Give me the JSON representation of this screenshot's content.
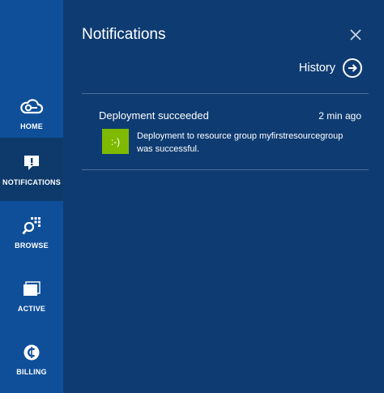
{
  "sidebar": {
    "items": [
      {
        "label": "HOME",
        "icon": "cloud-icon"
      },
      {
        "label": "NOTIFICATIONS",
        "icon": "notification-icon"
      },
      {
        "label": "BROWSE",
        "icon": "browse-icon"
      },
      {
        "label": "ACTIVE",
        "icon": "active-windows-icon"
      },
      {
        "label": "BILLING",
        "icon": "billing-icon"
      }
    ],
    "active_index": 1
  },
  "panel": {
    "title": "Notifications",
    "history_label": "History",
    "notifications": [
      {
        "title": "Deployment succeeded",
        "time": "2 min ago",
        "badge": ":-)",
        "message": "Deployment to resource group myfirstresourcegroup was successful."
      }
    ]
  },
  "colors": {
    "sidebar_bg": "#0f4f9a",
    "sidebar_active_bg": "#0d3a6b",
    "panel_bg": "#0e3c72",
    "success_badge": "#7fba00",
    "text": "#ffffff"
  }
}
